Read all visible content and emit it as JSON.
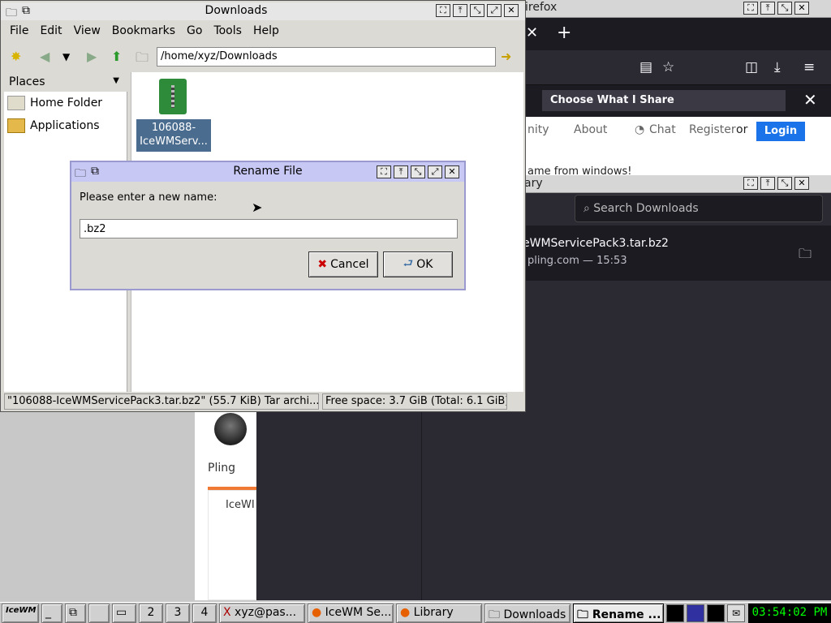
{
  "firefox": {
    "title": "Firefox",
    "share_banner": "Choose What I Share",
    "nav": {
      "community": "nity",
      "about": "About",
      "chat": "Chat",
      "register": "Register",
      "or": "or",
      "login": "Login"
    },
    "page_text": "ame from windows!"
  },
  "library": {
    "title": "ary",
    "search_placeholder": "Search Downloads",
    "download": {
      "name": "eWMServicePack3.tar.bz2",
      "meta": "pling.com — 15:53"
    }
  },
  "pling": {
    "name": "Pling",
    "item": "IceWI"
  },
  "file_manager": {
    "title": "Downloads",
    "menu": [
      "File",
      "Edit",
      "View",
      "Bookmarks",
      "Go",
      "Tools",
      "Help"
    ],
    "path": "/home/xyz/Downloads",
    "places_header": "Places",
    "places": [
      {
        "label": "Home Folder"
      },
      {
        "label": "Applications"
      }
    ],
    "file": {
      "label_line1": "106088-",
      "label_line2": "IceWMServ..."
    },
    "status_file": "\"106088-IceWMServicePack3.tar.bz2\" (55.7 KiB) Tar archi...",
    "status_space": "Free space: 3.7 GiB (Total: 6.1 GiB)"
  },
  "rename_dialog": {
    "title": "Rename File",
    "prompt": "Please enter a new name:",
    "value": ".bz2",
    "cancel": "Cancel",
    "ok": "OK"
  },
  "taskbar": {
    "start": "IceWM",
    "workspaces": [
      "2",
      "3",
      "4"
    ],
    "tasks": [
      {
        "label": "xyz@pas..."
      },
      {
        "label": "IceWM Se..."
      },
      {
        "label": "Library"
      },
      {
        "label": "Downloads"
      },
      {
        "label": "Rename ..."
      }
    ],
    "clock": "03:54:02 PM"
  },
  "colors": {
    "accent": "#1a73e8",
    "selection": "#4a6c8e",
    "dialog_title": "#c8c8f4"
  }
}
